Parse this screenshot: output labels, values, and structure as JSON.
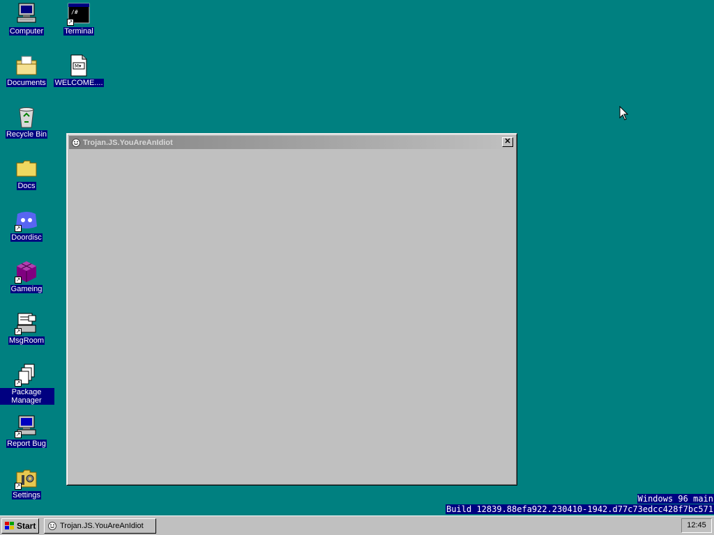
{
  "desktop": {
    "icons": [
      {
        "label": "Computer",
        "icon": "computer-icon"
      },
      {
        "label": "Terminal",
        "icon": "terminal-icon"
      },
      {
        "label": "Documents",
        "icon": "documents-folder-icon"
      },
      {
        "label": "WELCOME....",
        "icon": "markdown-file-icon"
      },
      {
        "label": "Recycle Bin",
        "icon": "recycle-bin-icon"
      },
      {
        "label": "Docs",
        "icon": "folder-icon"
      },
      {
        "label": "Doordisc",
        "icon": "doordisc-icon"
      },
      {
        "label": "Gameing",
        "icon": "gameing-icon"
      },
      {
        "label": "MsgRoom",
        "icon": "msgroom-icon"
      },
      {
        "label": "Package Manager",
        "icon": "package-manager-icon"
      },
      {
        "label": "Report Bug",
        "icon": "report-bug-icon"
      },
      {
        "label": "Settings",
        "icon": "settings-icon"
      }
    ],
    "terminal_glyph": "/#",
    "file_glyph": "M▾",
    "shortcut_glyph": "↗"
  },
  "window": {
    "title": "Trojan.JS.YouAreAnIdiot",
    "close_glyph": "✕"
  },
  "watermark": {
    "line1": "Windows 96 main",
    "line2": "Build 12839.88efa922.230410-1942.d77c73edcc428f7bc571"
  },
  "taskbar": {
    "start_label": "Start",
    "task_label": "Trojan.JS.YouAreAnIdiot",
    "clock": "12:45"
  },
  "colors": {
    "desktop": "#008080",
    "selection": "#000080",
    "face": "#c0c0c0"
  }
}
